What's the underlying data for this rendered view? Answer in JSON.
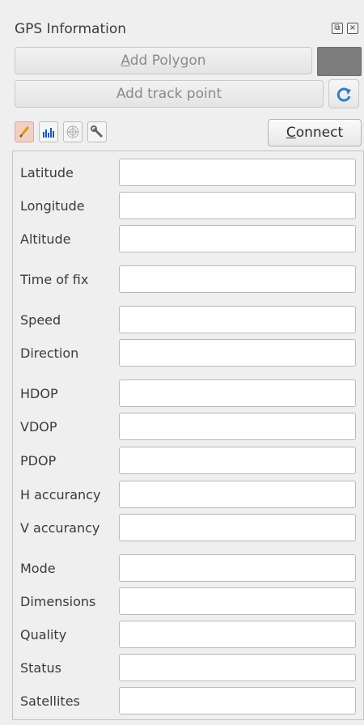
{
  "panel": {
    "title": "GPS Information",
    "float_icon": "float-icon",
    "close_icon": "close-icon"
  },
  "buttons": {
    "add_polygon_prefix": "",
    "add_polygon_mnemonic": "A",
    "add_polygon_rest": "dd Polygon",
    "add_track_point": "Add track point",
    "connect_mnemonic": "C",
    "connect_rest": "onnect",
    "polygon_color": "#7c7c7c"
  },
  "toolbar": {
    "tools": [
      "pencil-icon",
      "bar-chart-icon",
      "satellite-radar-icon",
      "wrench-icon"
    ],
    "refresh_icon": "refresh-icon"
  },
  "fields": [
    {
      "label": "Latitude",
      "value": ""
    },
    {
      "label": "Longitude",
      "value": ""
    },
    {
      "label": "Altitude",
      "value": ""
    },
    {
      "label": "Time of fix",
      "value": ""
    },
    {
      "label": "Speed",
      "value": ""
    },
    {
      "label": "Direction",
      "value": ""
    },
    {
      "label": "HDOP",
      "value": ""
    },
    {
      "label": "VDOP",
      "value": ""
    },
    {
      "label": "PDOP",
      "value": ""
    },
    {
      "label": "H accurancy",
      "value": ""
    },
    {
      "label": "V accurancy",
      "value": ""
    },
    {
      "label": "Mode",
      "value": ""
    },
    {
      "label": "Dimensions",
      "value": ""
    },
    {
      "label": "Quality",
      "value": ""
    },
    {
      "label": "Status",
      "value": ""
    },
    {
      "label": "Satellites",
      "value": ""
    }
  ]
}
